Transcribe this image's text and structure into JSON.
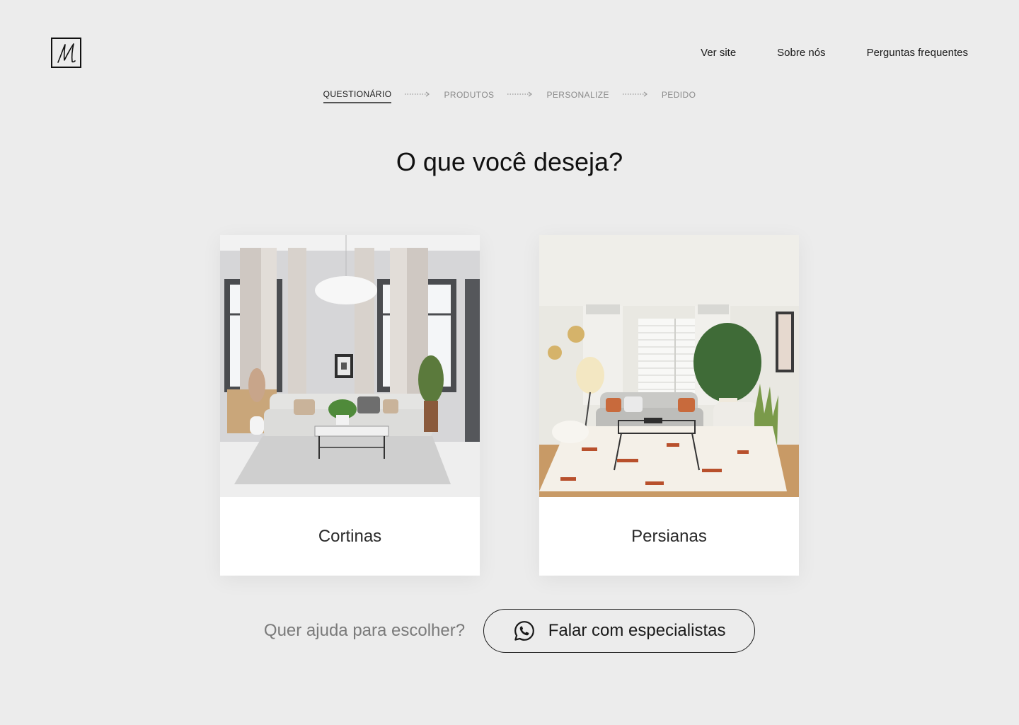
{
  "nav": {
    "items": [
      {
        "label": "Ver site"
      },
      {
        "label": "Sobre nós"
      },
      {
        "label": "Perguntas frequentes"
      }
    ]
  },
  "steps": [
    {
      "label": "QUESTIONÁRIO",
      "active": true
    },
    {
      "label": "PRODUTOS",
      "active": false
    },
    {
      "label": "PERSONALIZE",
      "active": false
    },
    {
      "label": "PEDIDO",
      "active": false
    }
  ],
  "page": {
    "title": "O que você deseja?"
  },
  "options": [
    {
      "label": "Cortinas",
      "image": "living-room-curtains"
    },
    {
      "label": "Persianas",
      "image": "living-room-blinds"
    }
  ],
  "help": {
    "question": "Quer ajuda para escolher?",
    "cta_label": "Falar com especialistas",
    "cta_icon": "whatsapp-icon"
  },
  "colors": {
    "background": "#ececec",
    "card": "#ffffff",
    "text": "#1a1a1a",
    "muted": "#8a8a8a"
  }
}
